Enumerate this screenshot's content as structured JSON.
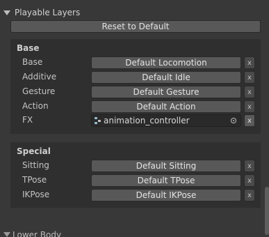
{
  "header": {
    "title": "Playable Layers"
  },
  "reset_label": "Reset to Default",
  "base": {
    "title": "Base",
    "rows": [
      {
        "label": "Base",
        "value": "Default Locomotion"
      },
      {
        "label": "Additive",
        "value": "Default Idle"
      },
      {
        "label": "Gesture",
        "value": "Default Gesture"
      },
      {
        "label": "Action",
        "value": "Default Action"
      }
    ],
    "fx": {
      "label": "FX",
      "value": "animation_controller"
    }
  },
  "special": {
    "title": "Special",
    "rows": [
      {
        "label": "Sitting",
        "value": "Default Sitting"
      },
      {
        "label": "TPose",
        "value": "Default TPose"
      },
      {
        "label": "IKPose",
        "value": "Default IKPose"
      }
    ]
  },
  "clear_label": "x",
  "bottom_header": {
    "title": "Lower Body"
  }
}
